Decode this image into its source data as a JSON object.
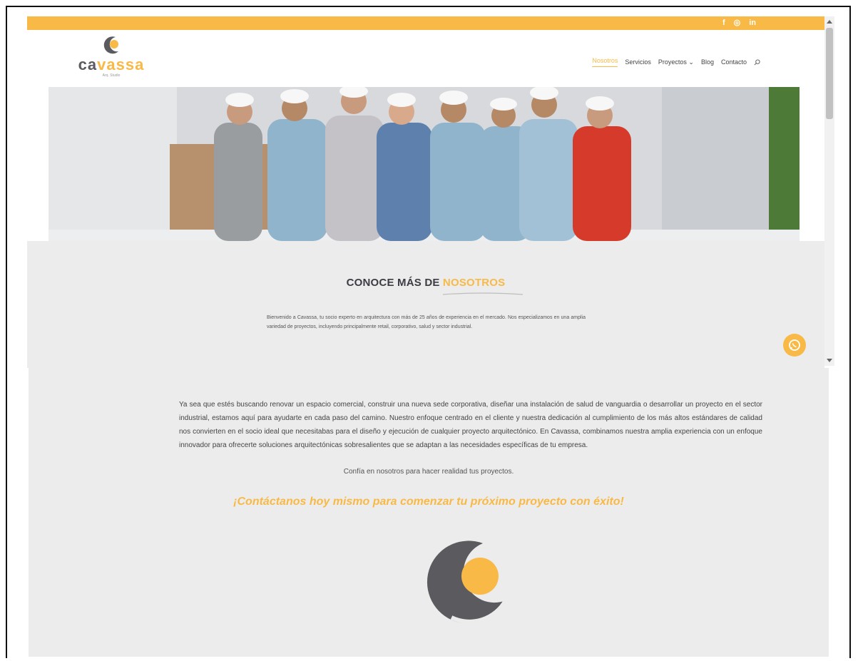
{
  "topbar": {
    "social": [
      {
        "icon": "facebook-icon",
        "label": "f"
      },
      {
        "icon": "instagram-icon",
        "label": "◎"
      },
      {
        "icon": "linkedin-icon",
        "label": "in"
      }
    ]
  },
  "brand": {
    "name_dark_1": "ca",
    "name_gold": "va",
    "name_dark_2": "ssa",
    "tagline": "Arq. Studio"
  },
  "nav": {
    "items": [
      {
        "label": "Nosotros",
        "active": true
      },
      {
        "label": "Servicios",
        "active": false
      },
      {
        "label": "Proyectos ⌄",
        "active": false
      },
      {
        "label": "Blog",
        "active": false
      },
      {
        "label": "Contacto",
        "active": false
      }
    ],
    "search_icon": "search-icon"
  },
  "about": {
    "title_dark": "CONOCE MÁS DE ",
    "title_gold": "NOSOTROS",
    "intro": "Bienvenido a Cavassa, tu socio experto en arquitectura con más de 25 años de experiencia en el mercado. Nos especializamos en una amplia variedad de proyectos, incluyendo principalmente retail, corporativo, salud y sector industrial."
  },
  "main": {
    "body": "Ya sea que estés buscando renovar un espacio comercial, construir una nueva sede corporativa, diseñar una instalación de salud de vanguardia o desarrollar un proyecto en el sector industrial, estamos aquí para ayudarte en cada paso del camino. Nuestro enfoque centrado en el cliente y nuestra dedicación al cumplimiento de los más altos estándares de calidad nos convierten en el socio ideal que necesitabas para el diseño y ejecución de cualquier proyecto arquitectónico. En Cavassa, combinamos nuestra amplia experiencia con un enfoque innovador para ofrecerte soluciones arquitectónicas sobresalientes que se adaptan a las necesidades específicas de tu empresa.",
    "trust": "Confía en nosotros para hacer realidad tus proyectos.",
    "cta": "¡Contáctanos hoy mismo para comenzar tu próximo proyecto con éxito!"
  },
  "colors": {
    "accent": "#f8b946",
    "dark": "#5a5a5f",
    "section_bg": "#ececec"
  }
}
